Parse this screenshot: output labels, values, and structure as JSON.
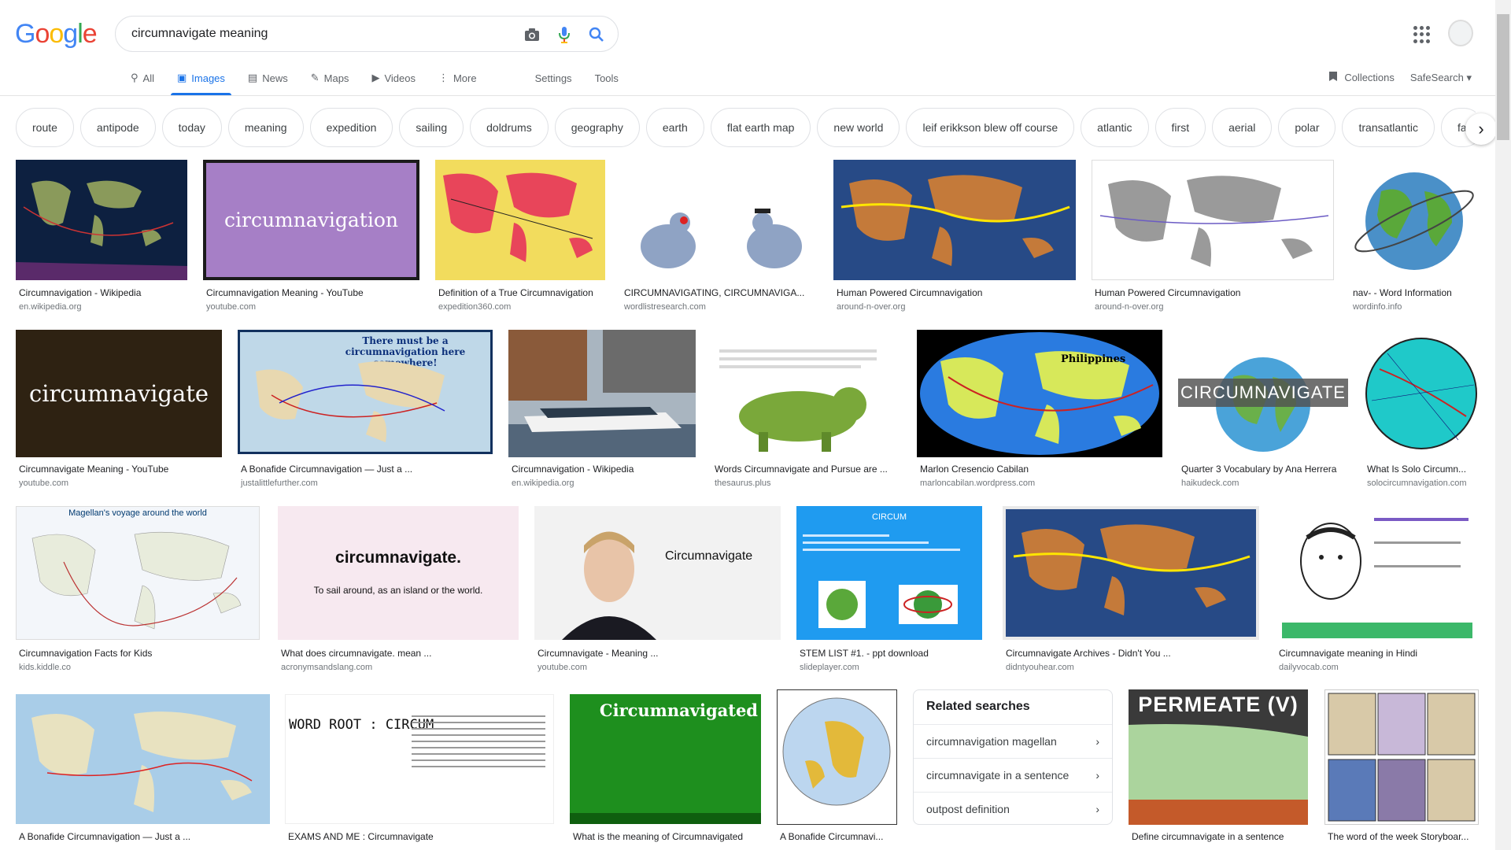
{
  "app": {
    "logo_letters": [
      "G",
      "o",
      "o",
      "g",
      "l",
      "e"
    ]
  },
  "search": {
    "query": "circumnavigate meaning"
  },
  "tabs": [
    {
      "label": "All",
      "icon": "search-icon"
    },
    {
      "label": "Images",
      "icon": "image-icon",
      "active": true
    },
    {
      "label": "News",
      "icon": "news-icon"
    },
    {
      "label": "Maps",
      "icon": "map-icon"
    },
    {
      "label": "Videos",
      "icon": "video-icon"
    },
    {
      "label": "More",
      "icon": "more-vert-icon"
    }
  ],
  "tools": {
    "settings": "Settings",
    "tools": "Tools",
    "collections": "Collections",
    "safesearch": "SafeSearch"
  },
  "chips": [
    "route",
    "antipode",
    "today",
    "meaning",
    "expedition",
    "sailing",
    "doldrums",
    "geography",
    "earth",
    "flat earth map",
    "new world",
    "leif erikkson blew off course",
    "atlantic",
    "first",
    "aerial",
    "polar",
    "transatlantic",
    "fa"
  ],
  "results": [
    {
      "title": "Circumnavigation - Wikipedia",
      "source": "en.wikipedia.org"
    },
    {
      "title": "Circumnavigation Meaning - YouTube",
      "source": "youtube.com",
      "thumb_text": "circumnavigation"
    },
    {
      "title": "Definition of a True Circumnavigation",
      "source": "expedition360.com"
    },
    {
      "title": "CIRCUMNAVIGATING, CIRCUMNAVIGA...",
      "source": "wordlistresearch.com"
    },
    {
      "title": "Human Powered Circumnavigation",
      "source": "around-n-over.org"
    },
    {
      "title": "Human Powered Circumnavigation",
      "source": "around-n-over.org"
    },
    {
      "title": "nav- - Word Information",
      "source": "wordinfo.info"
    },
    {
      "title": "Circumnavigate Meaning - YouTube",
      "source": "youtube.com",
      "thumb_text": "circumnavigate"
    },
    {
      "title": "A Bonafide Circumnavigation — Just a ...",
      "source": "justalittlefurther.com",
      "thumb_text": "There must be a circumnavigation here somewhere!"
    },
    {
      "title": "Circumnavigation - Wikipedia",
      "source": "en.wikipedia.org"
    },
    {
      "title": "Words Circumnavigate and Pursue are ...",
      "source": "thesaurus.plus"
    },
    {
      "title": "Marlon Cresencio Cabilan",
      "source": "marloncabilan.wordpress.com",
      "thumb_text": "Philippines"
    },
    {
      "title": "Quarter 3 Vocabulary by Ana Herrera",
      "source": "haikudeck.com",
      "thumb_text": "CIRCUMNAVIGATE"
    },
    {
      "title": "What Is Solo Circumn...",
      "source": "solocircumnavigation.com"
    },
    {
      "title": "Circumnavigation Facts for Kids",
      "source": "kids.kiddle.co",
      "thumb_text": "Magellan's voyage around the world"
    },
    {
      "title": "What does circumnavigate. mean ...",
      "source": "acronymsandslang.com",
      "thumb_text": "circumnavigate.",
      "thumb_sub": "To sail around, as an island or the world."
    },
    {
      "title": "Circumnavigate - Meaning ...",
      "source": "youtube.com",
      "thumb_text": "Circumnavigate"
    },
    {
      "title": "STEM LIST #1. - ppt download",
      "source": "slideplayer.com",
      "thumb_text": "CIRCUM"
    },
    {
      "title": "Circumnavigate Archives - Didn't You ...",
      "source": "didntyouhear.com"
    },
    {
      "title": "Circumnavigate meaning in Hindi",
      "source": "dailyvocab.com"
    },
    {
      "title": "A Bonafide Circumnavigation — Just a ...",
      "source": ""
    },
    {
      "title": "EXAMS AND ME : Circumnavigate",
      "source": "",
      "thumb_text": "WORD ROOT : CIRCUM"
    },
    {
      "title": "What is the meaning of Circumnavigated",
      "source": "",
      "thumb_text": "Circumnavigated"
    },
    {
      "title": "A Bonafide Circumnavi...",
      "source": ""
    },
    {
      "title": "Define circumnavigate in a sentence",
      "source": "",
      "thumb_text": "PERMEATE (V)"
    },
    {
      "title": "The word of the week Storyboar...",
      "source": ""
    }
  ],
  "related": {
    "heading": "Related searches",
    "items": [
      "circumnavigation magellan",
      "circumnavigate in a sentence",
      "outpost definition"
    ]
  },
  "colors": {
    "accent": "#1a73e8",
    "text_secondary": "#70757a",
    "border": "#dfe1e5"
  }
}
